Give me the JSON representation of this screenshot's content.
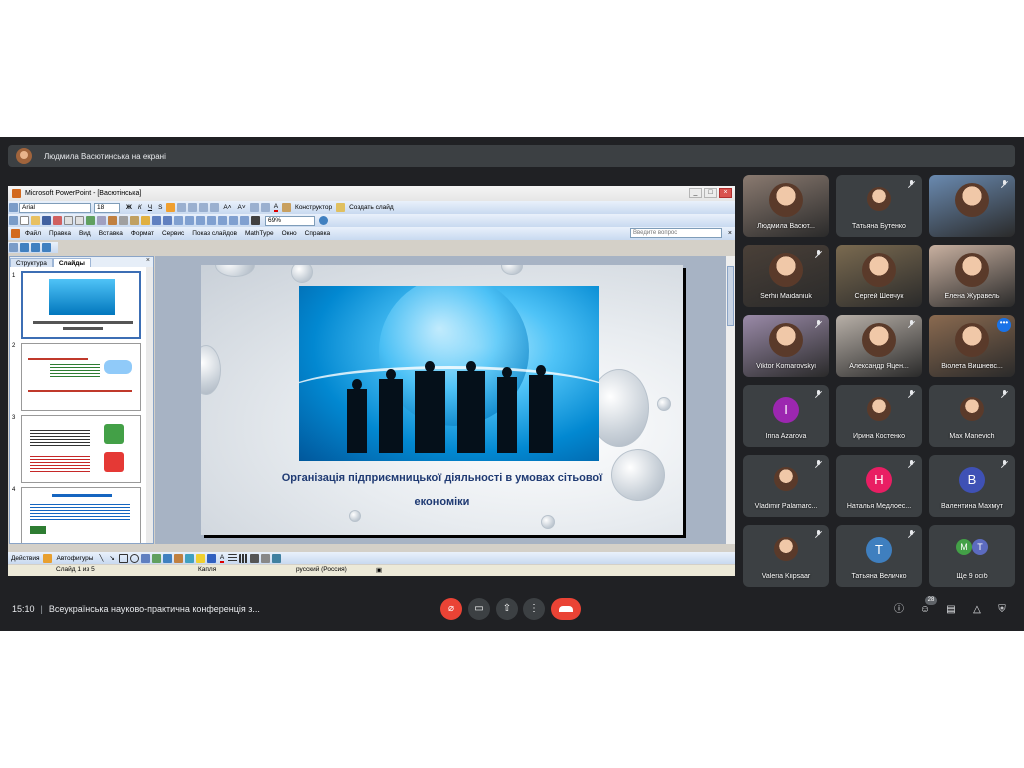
{
  "banner": {
    "text": "Людмила Васютинська на екрані"
  },
  "ppt": {
    "title": "Microsoft PowerPoint - [Васютінська]",
    "font": "Arial",
    "font_size": "18",
    "designer": "Конструктор",
    "new_slide": "Создать слайд",
    "zoom": "69%",
    "menu": [
      "Файл",
      "Правка",
      "Вид",
      "Вставка",
      "Формат",
      "Сервис",
      "Показ слайдов",
      "MathType",
      "Окно",
      "Справка"
    ],
    "ask_placeholder": "Введите вопрос",
    "tabs": [
      "Структура",
      "Слайды"
    ],
    "slide_numbers": [
      "1",
      "2",
      "3",
      "4"
    ],
    "slide_title": "Організація підприємницької діяльності в умовах сітьової економіки",
    "draw": {
      "actions": "Действия",
      "autoshapes": "Автофигуры"
    },
    "status": {
      "slide": "Слайд 1 из 5",
      "design": "Капля",
      "lang": "русский (Россия)"
    }
  },
  "participants": [
    {
      "name": "Людмила Васют...",
      "kind": "video",
      "bg": "#8a7a70"
    },
    {
      "name": "Татьяна Бутенко",
      "kind": "face",
      "muted": true
    },
    {
      "name": "",
      "kind": "video",
      "bg": "#6a8ab0",
      "muted": true
    },
    {
      "name": "Serhii Maidaniuk",
      "kind": "video",
      "bg": "#4a4038",
      "muted": true
    },
    {
      "name": "Сергей Шевчук",
      "kind": "video",
      "bg": "#7a6a50"
    },
    {
      "name": "Елена Журавель",
      "kind": "video",
      "bg": "#c8b0a0"
    },
    {
      "name": "Viktor Komarovskyi",
      "kind": "video",
      "bg": "#9a8aa8",
      "muted": true
    },
    {
      "name": "Александр Яцен...",
      "kind": "video",
      "bg": "#b8b0a8",
      "muted": true
    },
    {
      "name": "Віолета Вишневс...",
      "kind": "video",
      "bg": "#8a6a50",
      "more": true
    },
    {
      "name": "Irina Azarova",
      "kind": "letter",
      "letter": "I",
      "color": "#9c27b0",
      "muted": true
    },
    {
      "name": "Ирина Костенко",
      "kind": "face",
      "muted": true
    },
    {
      "name": "Max Manevich",
      "kind": "face",
      "muted": true
    },
    {
      "name": "Vladimir Palamarc...",
      "kind": "face",
      "muted": true
    },
    {
      "name": "Наталья Медлоес...",
      "kind": "letter",
      "letter": "Н",
      "color": "#e91e63",
      "muted": true
    },
    {
      "name": "Валентина Махмут",
      "kind": "letter",
      "letter": "В",
      "color": "#3f51b5",
      "muted": true
    },
    {
      "name": "Valeria Kiipsaar",
      "kind": "face",
      "muted": true
    },
    {
      "name": "Татьяна Величко",
      "kind": "letter",
      "letter": "Т",
      "color": "#3f7fbf",
      "muted": true
    },
    {
      "name": "Ще 9 осіб",
      "kind": "more",
      "letters": [
        "M",
        "T"
      ]
    }
  ],
  "bottom": {
    "time": "15:10",
    "meeting": "Всеукраїнська науково-практична конференція з...",
    "participant_count": "28"
  },
  "colors": {
    "meet_bg": "#202124",
    "tile_bg": "#3c4043",
    "end_call": "#ea4335"
  }
}
